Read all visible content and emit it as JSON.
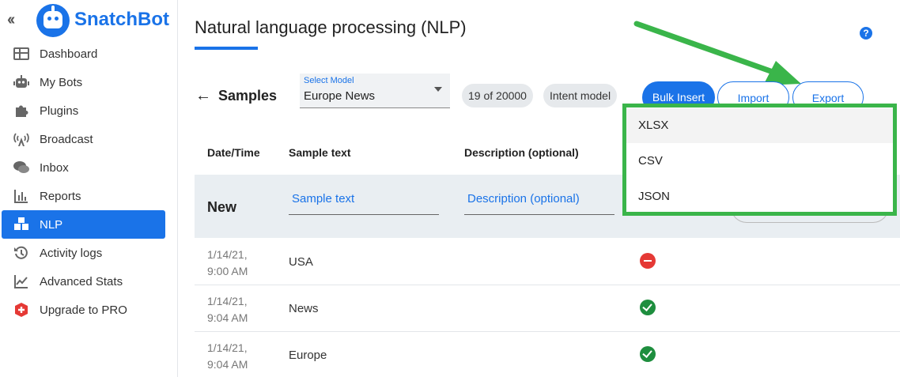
{
  "app": {
    "brand": "SnatchBot"
  },
  "sidebar": {
    "items": [
      {
        "label": "Dashboard",
        "icon": "dashboard-icon"
      },
      {
        "label": "My Bots",
        "icon": "bot-icon"
      },
      {
        "label": "Plugins",
        "icon": "puzzle-icon"
      },
      {
        "label": "Broadcast",
        "icon": "broadcast-icon"
      },
      {
        "label": "Inbox",
        "icon": "chat-icon"
      },
      {
        "label": "Reports",
        "icon": "bar-chart-icon"
      },
      {
        "label": "NLP",
        "icon": "cubes-icon",
        "active": true
      },
      {
        "label": "Activity logs",
        "icon": "history-icon"
      },
      {
        "label": "Advanced Stats",
        "icon": "line-chart-icon"
      },
      {
        "label": "Upgrade to PRO",
        "icon": "plus-badge-icon"
      }
    ]
  },
  "page": {
    "title": "Natural language processing (NLP)",
    "help": "?"
  },
  "samples_bar": {
    "title": "Samples",
    "select_caption": "Select Model",
    "select_value": "Europe News",
    "count": "19 of 20000",
    "model_type": "Intent model",
    "bulk_insert": "Bulk Insert",
    "import": "Import",
    "export": "Export"
  },
  "table": {
    "headers": {
      "datetime": "Date/Time",
      "sample": "Sample text",
      "description": "Description (optional)"
    },
    "new_row": {
      "label": "New",
      "sample_placeholder": "Sample text",
      "description_placeholder": "Description (optional)"
    },
    "rows": [
      {
        "date": "1/14/21,",
        "time": "9:00 AM",
        "text": "USA",
        "status": "error"
      },
      {
        "date": "1/14/21,",
        "time": "9:04 AM",
        "text": "News",
        "status": "ok"
      },
      {
        "date": "1/14/21,",
        "time": "9:04 AM",
        "text": "Europe",
        "status": "ok"
      }
    ]
  },
  "export_menu": {
    "options": [
      "XLSX",
      "CSV",
      "JSON"
    ]
  },
  "colors": {
    "accent": "#1a73e8",
    "highlight_box": "#3ab54a",
    "error": "#e53935",
    "ok": "#1e8e3e"
  }
}
